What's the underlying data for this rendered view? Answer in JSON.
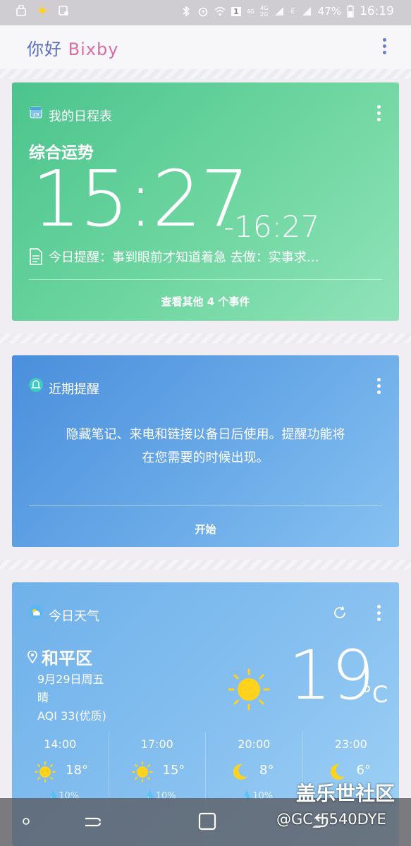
{
  "status_bar": {
    "network_labels": [
      "4G",
      "4G",
      "2G",
      "E"
    ],
    "sim_badge": "1",
    "battery": "47%",
    "time": "16:19"
  },
  "header": {
    "greeting": "你好",
    "brand": "Bixby"
  },
  "schedule_card": {
    "title": "我的日程表",
    "calendar_day": "29",
    "event_name": "综合运势",
    "start_time": "15:27",
    "end_time": "-16:27",
    "note": "今日提醒：事到眼前才知道着急 去做：实事求…",
    "link": "查看其他 4 个事件"
  },
  "reminder_card": {
    "title": "近期提醒",
    "body_line1": "隐藏笔记、来电和链接以备日后使用。提醒功能将",
    "body_line2": "在您需要的时候出现。",
    "link": "开始"
  },
  "weather_card": {
    "title": "今日天气",
    "location": "和平区",
    "date": "9月29日周五",
    "condition": "晴",
    "aqi": "AQI 33(优质)",
    "temperature": "19",
    "unit": "°C",
    "hourly": [
      {
        "time": "14:00",
        "icon": "sun-icon",
        "temp": "18°",
        "rain": "10%"
      },
      {
        "time": "17:00",
        "icon": "sun-icon",
        "temp": "15°",
        "rain": "10%"
      },
      {
        "time": "20:00",
        "icon": "moon-icon",
        "temp": "8°",
        "rain": "10%"
      },
      {
        "time": "23:00",
        "icon": "moon-icon",
        "temp": "6°",
        "rain": ""
      }
    ]
  },
  "watermark": {
    "line1": "盖乐世社区",
    "line2": "@GC_F540DYE"
  },
  "colors": {
    "schedule_card": "#5fcf98",
    "reminder_card": "#66a6e6",
    "weather_card": "#86c0f0",
    "sun": "#ffd21e"
  }
}
